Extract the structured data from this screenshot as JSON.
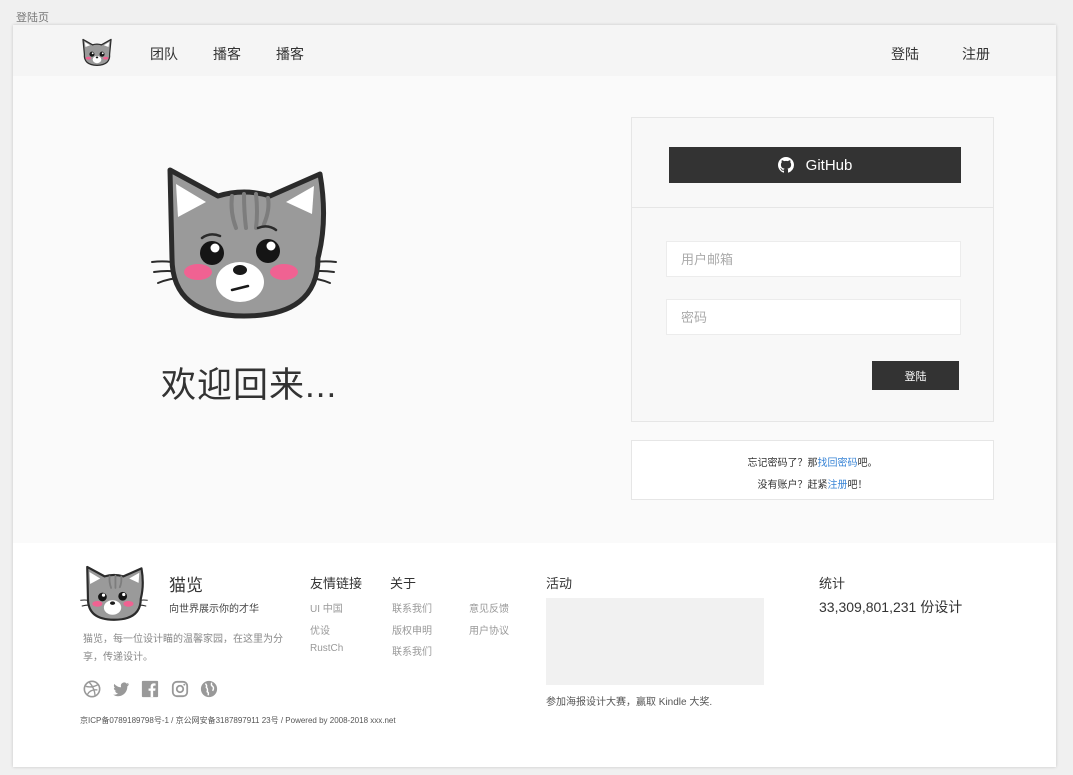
{
  "page_label": "登陆页",
  "header": {
    "nav": [
      "团队",
      "播客",
      "播客"
    ],
    "login": "登陆",
    "register": "注册"
  },
  "hero": {
    "welcome": "欢迎回来..."
  },
  "login": {
    "github_label": "GitHub",
    "email_placeholder": "用户邮箱",
    "password_placeholder": "密码",
    "submit_label": "登陆"
  },
  "help": {
    "forgot_prefix": "忘记密码了？那",
    "forgot_link": "找回密码",
    "forgot_suffix": "吧。",
    "noacc_prefix": "没有账户？赶紧",
    "noacc_link": "注册",
    "noacc_suffix": "吧！"
  },
  "footer": {
    "brand_name": "猫览",
    "slogan": "向世界展示你的才华",
    "description": "猫览，每一位设计瞄的温馨家园，在这里为分享，传递设计。",
    "social_icons": [
      "dribbble-icon",
      "twitter-icon",
      "facebook-icon",
      "instagram-icon",
      "globe-icon"
    ],
    "copyright": "京ICP备0789189798号-1 / 京公网安备3187897911 23号 / Powered by 2008-2018 xxx.net",
    "friends": {
      "title": "友情链接",
      "links": [
        "UI 中国",
        "优设",
        "RustCh"
      ]
    },
    "about": {
      "title": "关于",
      "links_col1": [
        "联系我们",
        "版权申明",
        "联系我们"
      ],
      "links_col2": [
        "意见反馈",
        "用户协议"
      ]
    },
    "activity": {
      "title": "活动",
      "text": "参加海报设计大赛，赢取 Kindle 大奖."
    },
    "stats": {
      "title": "统计",
      "value": "33,309,801,231 份设计"
    }
  },
  "colors": {
    "dark_button": "#333333",
    "link_blue": "#3a85d6",
    "cat_gray": "#9a9a9a",
    "cheek_pink": "#f06292"
  }
}
